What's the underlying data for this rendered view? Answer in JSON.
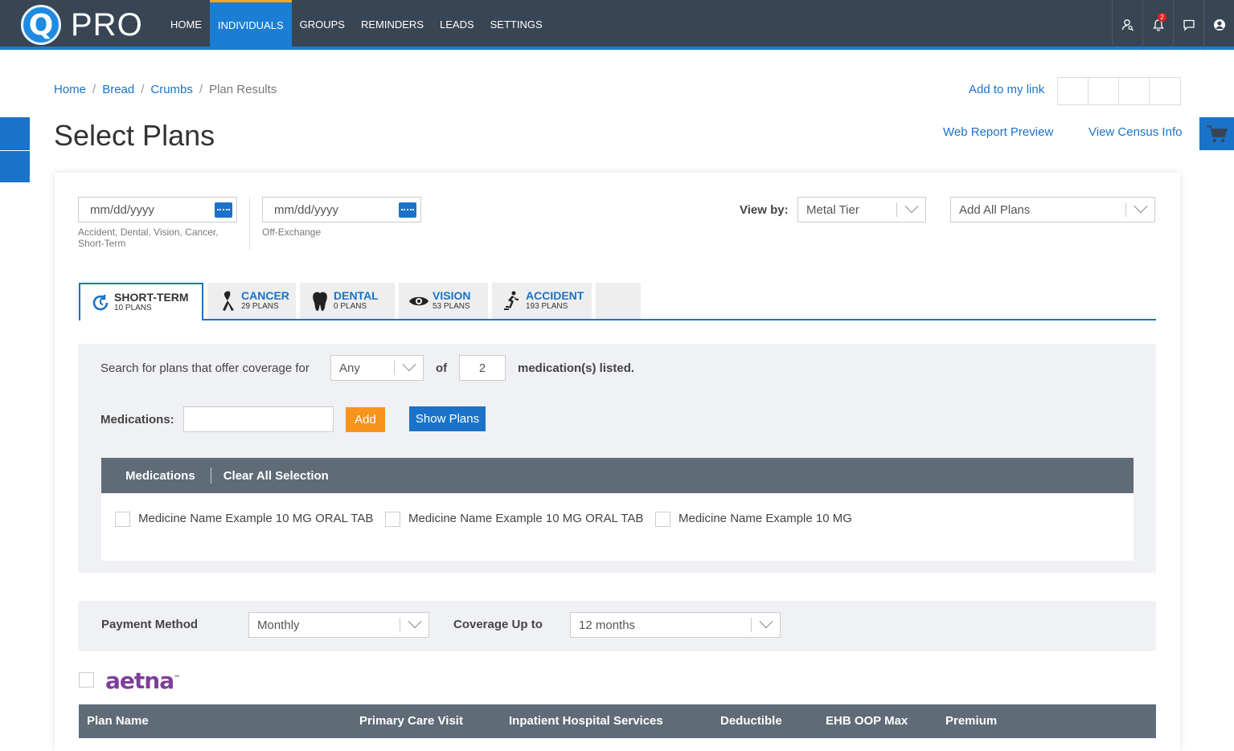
{
  "app": {
    "logo_letter": "Q",
    "logo_text": "PRO"
  },
  "nav": [
    {
      "label": "HOME"
    },
    {
      "label": "INDIVIDUALS"
    },
    {
      "label": "GROUPS"
    },
    {
      "label": "REMINDERS"
    },
    {
      "label": "LEADS"
    },
    {
      "label": "SETTINGS"
    }
  ],
  "nav_active": "INDIVIDUALS",
  "top_icons": {
    "user": "user-search-icon",
    "bell": "bell-icon",
    "bell_count": "2",
    "chat": "chat-icon",
    "account": "account-icon"
  },
  "breadcrumb": {
    "home": "Home",
    "bread": "Bread",
    "crumbs": "Crumbs",
    "current": "Plan Results",
    "sep": "/"
  },
  "header": {
    "add_link": "Add to my link",
    "title": "Select Plans",
    "web_report": "Web Report Preview",
    "census": "View Census Info"
  },
  "dates": {
    "date1_placeholder": "mm/dd/yyyy",
    "date1_help": "Accident, Dental, Vision, Cancer, Short-Term",
    "date2_placeholder": "mm/dd/yyyy",
    "date2_help": "Off-Exchange"
  },
  "view_by": {
    "label": "View by:",
    "value": "Metal Tier"
  },
  "add_all": {
    "value": "Add All Plans"
  },
  "tabs": [
    {
      "label": "SHORT-TERM",
      "sub": "10 PLANS",
      "icon": "refresh-icon"
    },
    {
      "label": "CANCER",
      "sub": "29 PLANS",
      "icon": "ribbon-icon"
    },
    {
      "label": "DENTAL",
      "sub": "0 PLANS",
      "icon": "tooth-icon"
    },
    {
      "label": "VISION",
      "sub": "53 PLANS",
      "icon": "eye-icon"
    },
    {
      "label": "ACCIDENT",
      "sub": "193 PLANS",
      "icon": "accident-icon"
    }
  ],
  "medication_search": {
    "prefix": "Search for plans that offer coverage for",
    "any_value": "Any",
    "of": "of",
    "count": "2",
    "suffix": "medication(s) listed.",
    "medications_label": "Medications:",
    "add_button": "Add",
    "show_button": "Show Plans",
    "list_header": "Medications",
    "clear_all": "Clear All Selection",
    "items": [
      "Medicine Name Example 10 MG ORAL TAB",
      "Medicine Name Example 10 MG ORAL TAB",
      "Medicine Name Example 10 MG"
    ]
  },
  "payment": {
    "method_label": "Payment Method",
    "method_value": "Monthly",
    "coverage_label": "Coverage Up to",
    "coverage_value": "12 months"
  },
  "carrier": {
    "name": "aetna",
    "mark": "™"
  },
  "table": {
    "columns": [
      "Plan Name",
      "Primary Care Visit",
      "Inpatient Hospital Services",
      "Deductible",
      "EHB OOP Max",
      "Premium"
    ]
  },
  "colors": {
    "topbar": "#384554",
    "accent": "#1a7ed4",
    "add_button": "#f7941d",
    "show_button": "#1a73c8",
    "aetna": "#7d3f98"
  }
}
